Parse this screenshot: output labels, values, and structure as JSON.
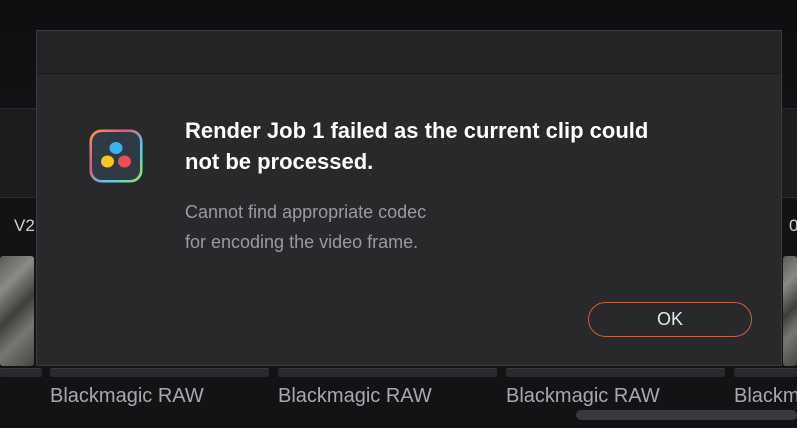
{
  "timeline": {
    "track_labels": [
      "V2",
      "0"
    ],
    "clip_names": [
      "Blackmagic RAW",
      "Blackmagic RAW",
      "Blackmagic RAW",
      "Blackm"
    ]
  },
  "dialog": {
    "app_icon": "davinci-resolve-icon",
    "title_line1": "Render Job 1 failed as the current clip could",
    "title_line2": "not be processed.",
    "message_line1": "Cannot find appropriate codec",
    "message_line2": "for encoding the video frame.",
    "ok_label": "OK",
    "accent_color": "#cc5d4b"
  }
}
